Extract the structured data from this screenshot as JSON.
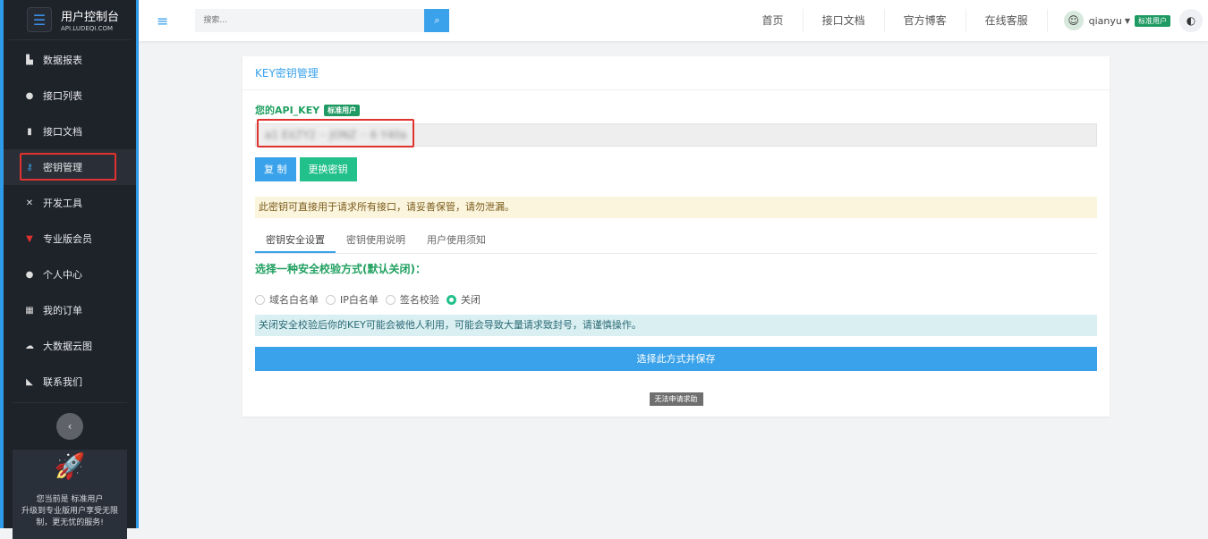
{
  "brand": {
    "title": "用户控制台",
    "subtitle": "API.LUDEQI.COM"
  },
  "sidebar": {
    "items": [
      {
        "label": "数据报表",
        "icon": "chart-icon"
      },
      {
        "label": "接口列表",
        "icon": "list-icon"
      },
      {
        "label": "接口文档",
        "icon": "book-icon"
      },
      {
        "label": "密钥管理",
        "icon": "key-icon"
      },
      {
        "label": "开发工具",
        "icon": "tools-icon"
      },
      {
        "label": "专业版会员",
        "icon": "vip-icon"
      },
      {
        "label": "个人中心",
        "icon": "user-icon"
      },
      {
        "label": "我的订单",
        "icon": "table-icon"
      },
      {
        "label": "大数据云图",
        "icon": "cloud-icon"
      },
      {
        "label": "联系我们",
        "icon": "rss-icon"
      }
    ],
    "promo": {
      "line1": "您当前是 标准用户",
      "line2": "升级到专业版用户享受无限",
      "line3": "制，更无忧的服务!"
    }
  },
  "header": {
    "search_placeholder": "搜索...",
    "nav": [
      "首页",
      "接口文档",
      "官方博客",
      "在线客服"
    ],
    "username": "qianyu",
    "badge": "标准用户"
  },
  "card": {
    "title": "KEY密钥管理",
    "key_label": "您的API_KEY",
    "key_badge": "标准用户",
    "key_value": "a1 EiLTY2 ·· JONZ ·· 6 Y4Ila",
    "copy": "复 制",
    "change": "更换密钥",
    "warning": "此密钥可直接用于请求所有接口，请妥善保管，请勿泄漏。",
    "tabs": [
      "密钥安全设置",
      "密钥使用说明",
      "用户使用须知"
    ],
    "section_title": "选择一种安全校验方式(默认关闭)：",
    "options": [
      "域名白名单",
      "IP白名单",
      "签名校验",
      "关闭"
    ],
    "selected": 3,
    "info": "关闭安全校验后你的KEY可能会被他人利用，可能会导致大量请求致封号，请谨慎操作。",
    "save": "选择此方式并保存",
    "tooltip": "无法申请求助"
  },
  "colors": {
    "accent": "#3aa2ea",
    "green": "#22c08a",
    "sidebar": "#1e2229"
  }
}
